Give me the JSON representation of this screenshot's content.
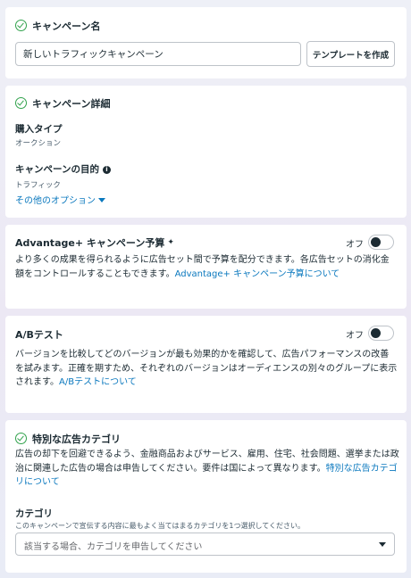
{
  "campaign_name": {
    "title": "キャンペーン名",
    "input_value": "新しいトラフィックキャンペーン",
    "template_button": "テンプレートを作成"
  },
  "campaign_details": {
    "title": "キャンペーン詳細",
    "buying_type_label": "購入タイプ",
    "buying_type_value": "オークション",
    "objective_label": "キャンペーンの目的",
    "objective_value": "トラフィック",
    "more_options_link": "その他のオプション"
  },
  "advantage_budget": {
    "title": "Advantage+ キャンペーン予算",
    "toggle_label": "オフ",
    "description": "より多くの成果を得られるように広告セット間で予算を配分できます。各広告セットの消化金額をコントロールすることもできます。",
    "link": "Advantage+ キャンペーン予算について"
  },
  "ab_test": {
    "title": "A/Bテスト",
    "toggle_label": "オフ",
    "description": "バージョンを比較してどのバージョンが最も効果的かを確認して、広告パフォーマンスの改善を試みます。正確を期すため、それぞれのバージョンはオーディエンスの別々のグループに表示されます。",
    "link": "A/Bテストについて"
  },
  "special_category": {
    "title": "特別な広告カテゴリ",
    "description": "広告の却下を回避できるよう、金融商品およびサービス、雇用、住宅、社会問題、選挙または政治に関連した広告の場合は申告してください。要件は国によって異なります。",
    "link": "特別な広告カテゴリについて",
    "category_label": "カテゴリ",
    "category_help": "このキャンペーンで宣伝する内容に最もよく当てはまるカテゴリを1つ選択してください。",
    "select_placeholder": "該当する場合、カテゴリを申告してください"
  },
  "colors": {
    "check_green": "#31a24c",
    "link_blue": "#0a78be",
    "text_dark": "#1c2b33",
    "toggle_knob": "#1c2b33"
  },
  "icons": [
    "check-circle-icon",
    "info-icon",
    "caret-down-icon",
    "sparkle-icon",
    "chevron-down-icon"
  ]
}
